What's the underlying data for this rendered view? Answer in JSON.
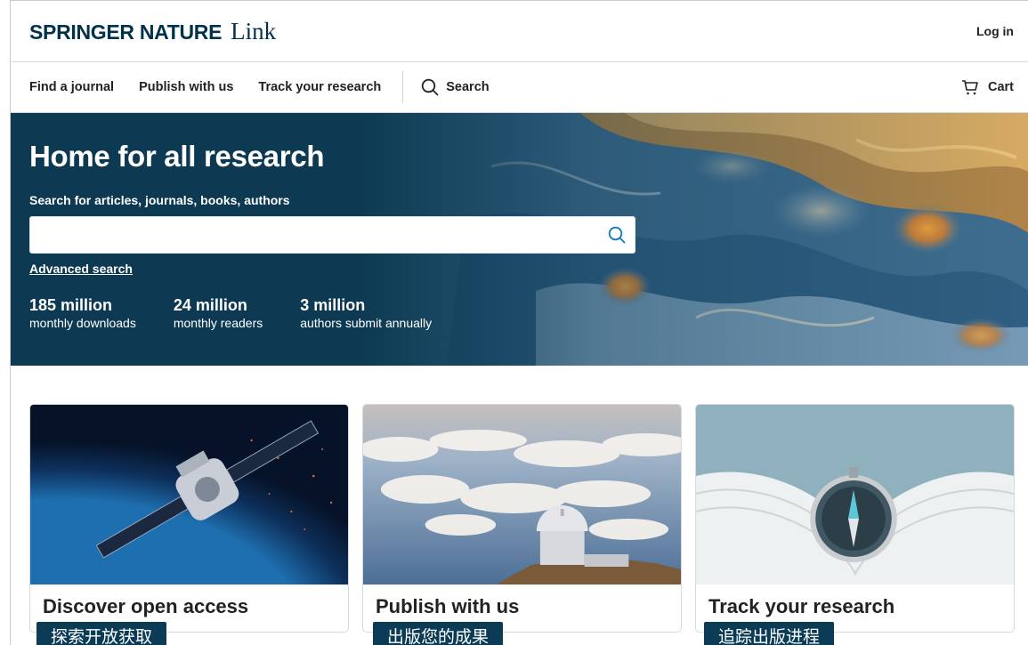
{
  "header": {
    "brand": "SPRINGER NATURE",
    "brand_suffix": "Link",
    "login": "Log in"
  },
  "nav": {
    "items": [
      "Find a journal",
      "Publish with us",
      "Track your research"
    ],
    "search": "Search",
    "cart": "Cart"
  },
  "hero": {
    "title": "Home for all research",
    "search_label": "Search for articles, journals, books, authors",
    "search_value": "",
    "advanced": "Advanced search",
    "stats": [
      {
        "value": "185 million",
        "label": "monthly downloads"
      },
      {
        "value": "24 million",
        "label": "monthly readers"
      },
      {
        "value": "3 million",
        "label": "authors submit annually"
      }
    ]
  },
  "cards": [
    {
      "title": "Discover open access",
      "badge": "探索开放获取"
    },
    {
      "title": "Publish with us",
      "badge": "出版您的成果"
    },
    {
      "title": "Track your research",
      "badge": "追踪出版进程"
    }
  ],
  "colors": {
    "brand": "#01324b",
    "hero_bg": "#0d3a52",
    "accent": "#0c7bbd"
  }
}
